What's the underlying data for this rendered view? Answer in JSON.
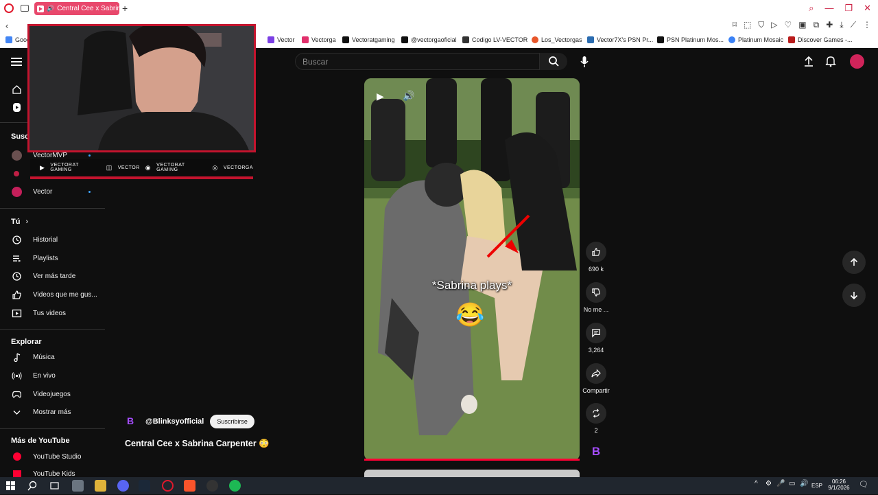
{
  "browser": {
    "tab_title": "Central Cee x Sabrina",
    "window_controls": [
      "⌕",
      "—",
      "❐",
      "✕"
    ],
    "bookmarks": [
      {
        "label": "Goog",
        "color": "#4285f4"
      },
      {
        "label": "Vector",
        "color": "#7b3fe4"
      },
      {
        "label": "Vectorga",
        "color": "#e1306c"
      },
      {
        "label": "Vectoratgaming",
        "color": "#111111"
      },
      {
        "label": "@vectorgaoficial",
        "color": "#111111"
      },
      {
        "label": "Codigo LV-VECTOR",
        "color": "#333333"
      },
      {
        "label": "Los_Vectorgas",
        "color": "#e8572b"
      },
      {
        "label": "Vector7X's PSN Pr...",
        "color": "#2b6cb0"
      },
      {
        "label": "PSN Platinum Mos...",
        "color": "#111111"
      },
      {
        "label": "Platinum Mosaic",
        "color": "#3b82f6"
      },
      {
        "label": "Discover Games -...",
        "color": "#b91c1c"
      }
    ]
  },
  "youtube": {
    "search_placeholder": "Buscar",
    "sidebar": {
      "subs_header": "Susc",
      "subscriptions": [
        {
          "label": "VectorMVP"
        },
        {
          "label": "Vector"
        }
      ],
      "you_header": "Tú",
      "you_items": [
        {
          "label": "Historial",
          "icon": "history-icon"
        },
        {
          "label": "Playlists",
          "icon": "playlist-icon"
        },
        {
          "label": "Ver más tarde",
          "icon": "watch-later-icon"
        },
        {
          "label": "Videos que me gus...",
          "icon": "thumbs-up-icon"
        },
        {
          "label": "Tus videos",
          "icon": "your-videos-icon"
        }
      ],
      "explore_header": "Explorar",
      "explore_items": [
        {
          "label": "Música",
          "icon": "music-icon"
        },
        {
          "label": "En vivo",
          "icon": "live-icon"
        },
        {
          "label": "Videojuegos",
          "icon": "gaming-icon"
        },
        {
          "label": "Mostrar más",
          "icon": "chevron-down-icon"
        }
      ],
      "more_header": "Más de YouTube",
      "more_items": [
        {
          "label": "YouTube Studio"
        },
        {
          "label": "YouTube Kids"
        }
      ]
    },
    "overlay": {
      "socials": [
        "VECTORAT GAMING",
        "VECTOR",
        "VECTORAT GAMING",
        "VECTORGA"
      ]
    },
    "short": {
      "caption": "*Sabrina plays*",
      "emoji": "😂",
      "channel": "@Blinksyofficial",
      "channel_logo": "B",
      "subscribe_label": "Suscribirse",
      "title": "Central Cee x Sabrina Carpenter 😳",
      "likes": "690 k",
      "dislike_label": "No me ...",
      "comments": "3,264",
      "share_label": "Compartir",
      "remix": "2"
    }
  },
  "taskbar": {
    "lang": "ESP",
    "time": "06:26",
    "date": "9/1/2026"
  }
}
